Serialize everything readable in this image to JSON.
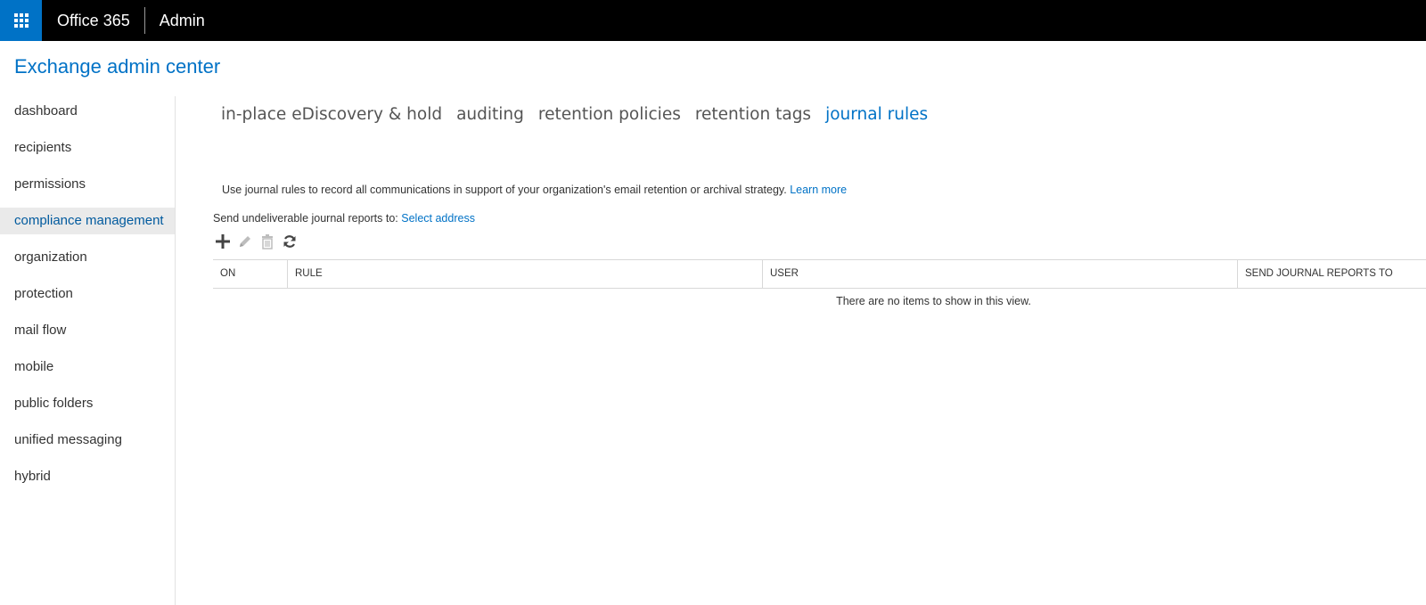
{
  "suite": {
    "brand": "Office 365",
    "section": "Admin"
  },
  "page": {
    "title": "Exchange admin center"
  },
  "nav": {
    "items": [
      {
        "label": "dashboard"
      },
      {
        "label": "recipients"
      },
      {
        "label": "permissions"
      },
      {
        "label": "compliance management",
        "active": true
      },
      {
        "label": "organization"
      },
      {
        "label": "protection"
      },
      {
        "label": "mail flow"
      },
      {
        "label": "mobile"
      },
      {
        "label": "public folders"
      },
      {
        "label": "unified messaging"
      },
      {
        "label": "hybrid"
      }
    ]
  },
  "tabs": [
    {
      "label": "in-place eDiscovery & hold"
    },
    {
      "label": "auditing"
    },
    {
      "label": "retention policies"
    },
    {
      "label": "retention tags"
    },
    {
      "label": "journal rules",
      "active": true
    }
  ],
  "content": {
    "description": "Use journal rules to record all communications in support of your organization's email retention or archival strategy.",
    "learn_more": "Learn more",
    "undeliverable_label": "Send undeliverable journal reports to:",
    "select_address": "Select address"
  },
  "toolbar": {
    "icons": [
      "add-icon",
      "edit-icon",
      "delete-icon",
      "refresh-icon"
    ]
  },
  "table": {
    "columns": [
      "ON",
      "RULE",
      "USER",
      "SEND JOURNAL REPORTS TO"
    ],
    "empty_message": "There are no items to show in this view."
  },
  "colors": {
    "accent": "#0072c6",
    "topbar": "#000000",
    "active_nav_bg": "#eaeaea"
  }
}
